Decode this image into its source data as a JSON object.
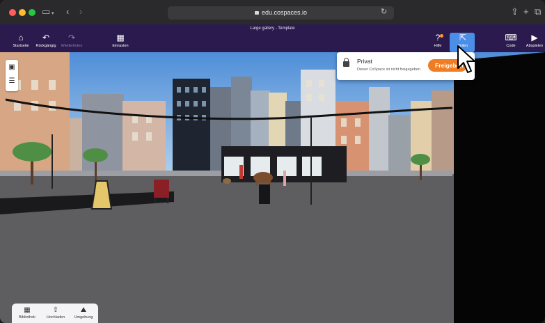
{
  "browser": {
    "url": "edu.cospaces.io",
    "icons": [
      "sidebar-toggle-icon",
      "back-icon",
      "forward-icon",
      "reload-icon",
      "share-icon",
      "new-tab-icon",
      "tab-overview-icon"
    ]
  },
  "app": {
    "doc_title": "Large gallery - Template",
    "left_buttons": [
      {
        "icon": "home-icon",
        "label": "Startseite"
      },
      {
        "icon": "undo-icon",
        "label": "Rückgängig"
      },
      {
        "icon": "redo-icon",
        "label": "Wiederholen"
      },
      {
        "icon": "grid-icon",
        "label": "Einrasten"
      }
    ],
    "right_buttons": [
      {
        "icon": "help-icon",
        "label": "Hilfe"
      },
      {
        "icon": "share-icon",
        "label": "Teilen"
      },
      {
        "icon": "code-icon",
        "label": "Code"
      },
      {
        "icon": "play-icon",
        "label": "Abspielen"
      }
    ],
    "accent_color": "#4b8ee8",
    "appbar_color": "#2b1a4e"
  },
  "side_toolbar": {
    "icons": [
      "gallery-icon",
      "list-icon"
    ]
  },
  "popup": {
    "title": "Privat",
    "subtitle": "Dieser CoSpace ist nicht freigegeben",
    "button_label": "Freigeben",
    "button_color": "#f07c23"
  },
  "bottom_tray": {
    "buttons": [
      {
        "icon": "library-icon",
        "label": "Bibliothek"
      },
      {
        "icon": "upload-icon",
        "label": "Hochladen"
      },
      {
        "icon": "environment-icon",
        "label": "Umgebung"
      }
    ]
  }
}
